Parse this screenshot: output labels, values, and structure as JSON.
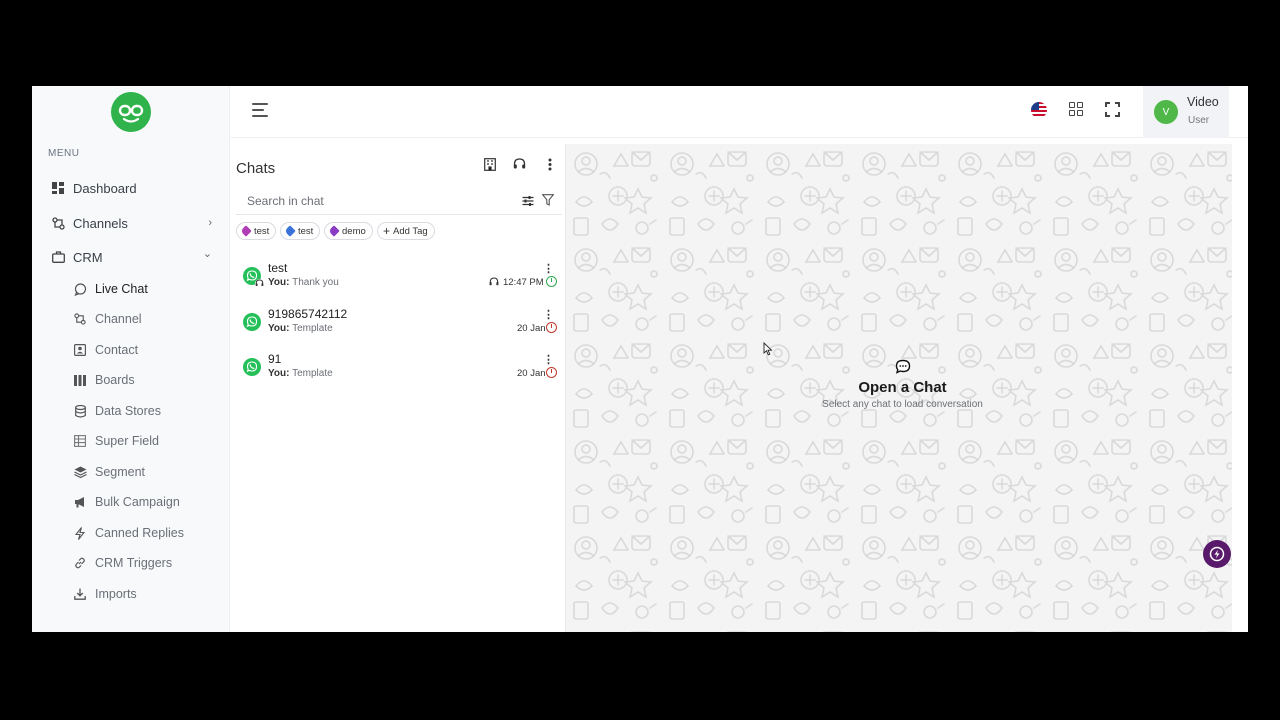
{
  "sidebar": {
    "menu_label": "MENU",
    "items": [
      {
        "label": "Dashboard",
        "icon": "dashboard-icon"
      },
      {
        "label": "Channels",
        "icon": "channels-icon",
        "chevron": "›"
      },
      {
        "label": "CRM",
        "icon": "briefcase-icon",
        "chevron": "⌄"
      }
    ],
    "crm_items": [
      {
        "label": "Live Chat",
        "icon": "chat-bubble-icon",
        "active": true
      },
      {
        "label": "Channel",
        "icon": "channel-icon"
      },
      {
        "label": "Contact",
        "icon": "contact-card-icon"
      },
      {
        "label": "Boards",
        "icon": "boards-icon"
      },
      {
        "label": "Data Stores",
        "icon": "database-icon"
      },
      {
        "label": "Super Field",
        "icon": "table-icon"
      },
      {
        "label": "Segment",
        "icon": "layers-icon"
      },
      {
        "label": "Bulk Campaign",
        "icon": "megaphone-icon"
      },
      {
        "label": "Canned Replies",
        "icon": "lightning-icon"
      },
      {
        "label": "CRM Triggers",
        "icon": "link-icon"
      },
      {
        "label": "Imports",
        "icon": "import-icon"
      }
    ]
  },
  "header": {
    "user_initial": "V",
    "user_name": "Video",
    "user_role": "User"
  },
  "chats": {
    "title": "Chats",
    "search_placeholder": "Search in chat",
    "tags": [
      {
        "label": "test",
        "color": "#b03cb6"
      },
      {
        "label": "test",
        "color": "#3a73d8"
      },
      {
        "label": "demo",
        "color": "#8b3cc4"
      }
    ],
    "add_tag_label": "Add Tag",
    "add_tag_plus": "+",
    "list": [
      {
        "name": "test",
        "preview_prefix": "You:",
        "preview": "Thank you",
        "time": "12:47 PM",
        "status_color": "green",
        "has_agent": true
      },
      {
        "name": "919865742112",
        "preview_prefix": "You:",
        "preview": "Template",
        "time": "20 Jan",
        "status_color": "red",
        "has_agent": false
      },
      {
        "name": "91",
        "preview_prefix": "You:",
        "preview": "Template",
        "time": "20 Jan",
        "status_color": "red",
        "has_agent": false
      }
    ]
  },
  "chat_area": {
    "empty_title": "Open a Chat",
    "empty_subtitle": "Select any chat to load conversation"
  },
  "colors": {
    "brand_green": "#2fb34a",
    "whatsapp_green": "#25c05a",
    "fab_purple": "#5a1a6b"
  }
}
